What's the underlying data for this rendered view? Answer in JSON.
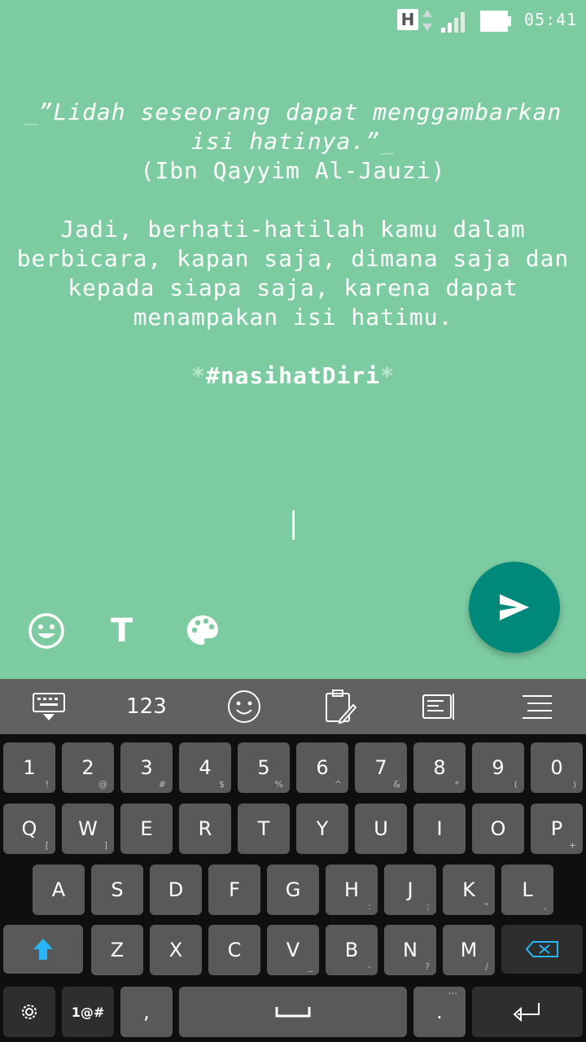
{
  "status_bar": {
    "network_type": "H",
    "time": "05:41"
  },
  "post": {
    "quote_prefix": "_",
    "quote_line1": "”Lidah seseorang dapat menggambarkan",
    "quote_line2": "isi hatinya.”",
    "quote_suffix": "_",
    "author": "(Ibn Qayyim Al-Jauzi)",
    "body_line1": "Jadi, berhati-hatilah kamu dalam",
    "body_line2": "berbicara, kapan saja, dimana saja dan",
    "body_line3": "kepada siapa saja, karena dapat",
    "body_line4": "menampakan isi hatimu.",
    "hashtag_prefix": "*",
    "hashtag": "#nasihatDiri",
    "hashtag_suffix": "*"
  },
  "tools": {
    "text_label": "T"
  },
  "keyboard": {
    "toolbar": {
      "numbers_label": "123"
    },
    "rows": {
      "numbers": [
        {
          "main": "1",
          "sub": "!"
        },
        {
          "main": "2",
          "sub": "@"
        },
        {
          "main": "3",
          "sub": "#"
        },
        {
          "main": "4",
          "sub": "$"
        },
        {
          "main": "5",
          "sub": "%"
        },
        {
          "main": "6",
          "sub": "^"
        },
        {
          "main": "7",
          "sub": "&"
        },
        {
          "main": "8",
          "sub": "*"
        },
        {
          "main": "9",
          "sub": "("
        },
        {
          "main": "0",
          "sub": ")"
        }
      ],
      "top": [
        {
          "main": "Q",
          "sub": "["
        },
        {
          "main": "W",
          "sub": "]"
        },
        {
          "main": "E",
          "sub": ""
        },
        {
          "main": "R",
          "sub": ""
        },
        {
          "main": "T",
          "sub": ""
        },
        {
          "main": "Y",
          "sub": ""
        },
        {
          "main": "U",
          "sub": ""
        },
        {
          "main": "I",
          "sub": ""
        },
        {
          "main": "O",
          "sub": ""
        },
        {
          "main": "P",
          "sub": "+"
        }
      ],
      "middle": [
        {
          "main": "A",
          "sub": ""
        },
        {
          "main": "S",
          "sub": ""
        },
        {
          "main": "D",
          "sub": ""
        },
        {
          "main": "F",
          "sub": ""
        },
        {
          "main": "G",
          "sub": ""
        },
        {
          "main": "H",
          "sub": ":"
        },
        {
          "main": "J",
          "sub": ";"
        },
        {
          "main": "K",
          "sub": "\""
        },
        {
          "main": "L",
          "sub": ","
        }
      ],
      "bottom": [
        {
          "main": "Z",
          "sub": ""
        },
        {
          "main": "X",
          "sub": ""
        },
        {
          "main": "C",
          "sub": ""
        },
        {
          "main": "V",
          "sub": "_"
        },
        {
          "main": "B",
          "sub": "-"
        },
        {
          "main": "N",
          "sub": "?"
        },
        {
          "main": "M",
          "sub": "/"
        }
      ]
    },
    "symbols_label": "1@#",
    "comma_label": ",",
    "period_label": ".",
    "period_sub": "..."
  },
  "colors": {
    "background": "#7ccba1",
    "send_button": "#00897b",
    "shift_accent": "#29b6f6"
  }
}
